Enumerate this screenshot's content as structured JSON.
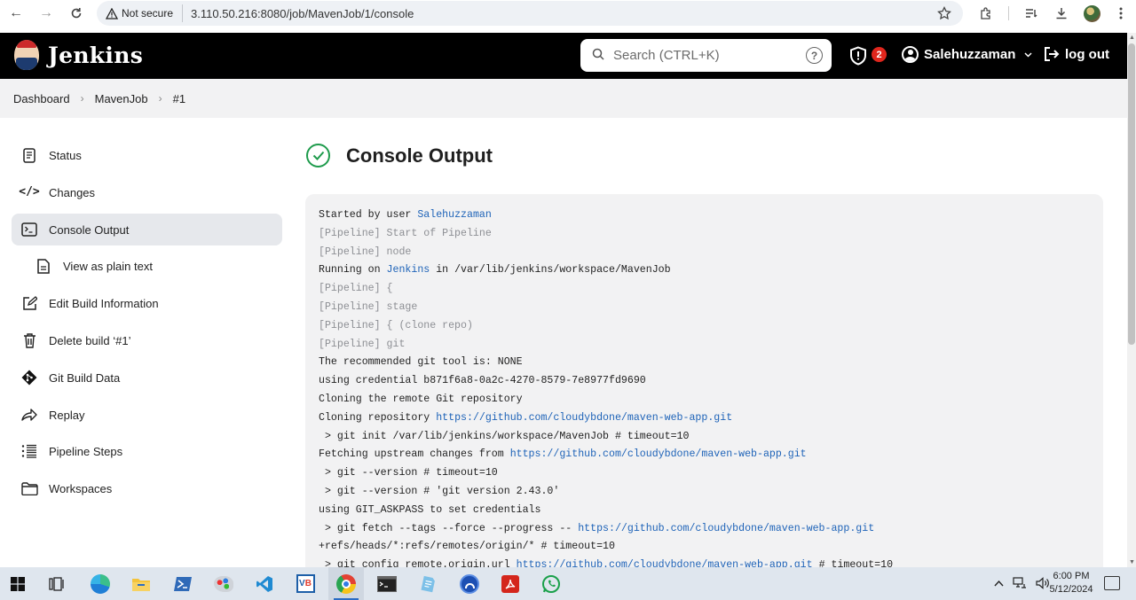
{
  "browser": {
    "security_label": "Not secure",
    "url": "3.110.50.216:8080/job/MavenJob/1/console"
  },
  "header": {
    "app_name": "Jenkins",
    "search_placeholder": "Search (CTRL+K)",
    "security_count": "2",
    "user_name": "Salehuzzaman",
    "logout_label": "log out"
  },
  "breadcrumb": [
    "Dashboard",
    "MavenJob",
    "#1"
  ],
  "sidebar": {
    "items": [
      {
        "label": "Status",
        "icon": "document-icon"
      },
      {
        "label": "Changes",
        "icon": "code-icon"
      },
      {
        "label": "Console Output",
        "icon": "terminal-icon"
      },
      {
        "label": "View as plain text",
        "icon": "file-text-icon"
      },
      {
        "label": "Edit Build Information",
        "icon": "edit-icon"
      },
      {
        "label": "Delete build ‘#1’",
        "icon": "trash-icon"
      },
      {
        "label": "Git Build Data",
        "icon": "git-icon"
      },
      {
        "label": "Replay",
        "icon": "replay-icon"
      },
      {
        "label": "Pipeline Steps",
        "icon": "list-icon"
      },
      {
        "label": "Workspaces",
        "icon": "folder-icon"
      }
    ]
  },
  "main": {
    "title": "Console Output",
    "status_color": "#1e9b4c"
  },
  "console": {
    "lines": [
      {
        "t": "Started by user ",
        "link": "Salehuzzaman",
        "rest": ""
      },
      {
        "pl": true,
        "t": "[Pipeline] Start of Pipeline"
      },
      {
        "pl": true,
        "t": "[Pipeline] node"
      },
      {
        "t": "Running on ",
        "link": "Jenkins",
        "rest": " in /var/lib/jenkins/workspace/MavenJob"
      },
      {
        "pl": true,
        "t": "[Pipeline] {"
      },
      {
        "pl": true,
        "t": "[Pipeline] stage"
      },
      {
        "pl": true,
        "t": "[Pipeline] { (clone repo)"
      },
      {
        "pl": true,
        "t": "[Pipeline] git"
      },
      {
        "t": "The recommended git tool is: NONE"
      },
      {
        "t": "using credential b871f6a8-0a2c-4270-8579-7e8977fd9690"
      },
      {
        "t": "Cloning the remote Git repository"
      },
      {
        "t": "Cloning repository ",
        "link": "https://github.com/cloudybdone/maven-web-app.git",
        "rest": ""
      },
      {
        "t": " > git init /var/lib/jenkins/workspace/MavenJob # timeout=10"
      },
      {
        "t": "Fetching upstream changes from ",
        "link": "https://github.com/cloudybdone/maven-web-app.git",
        "rest": ""
      },
      {
        "t": " > git --version # timeout=10"
      },
      {
        "t": " > git --version # 'git version 2.43.0'"
      },
      {
        "t": "using GIT_ASKPASS to set credentials"
      },
      {
        "t": " > git fetch --tags --force --progress -- ",
        "link": "https://github.com/cloudybdone/maven-web-app.git",
        "rest": ""
      },
      {
        "t": "+refs/heads/*:refs/remotes/origin/* # timeout=10"
      },
      {
        "t": " > git config remote.origin.url ",
        "link": "https://github.com/cloudybdone/maven-web-app.git",
        "rest": " # timeout=10"
      }
    ]
  },
  "taskbar": {
    "time": "6:00 PM",
    "date": "5/12/2024"
  }
}
